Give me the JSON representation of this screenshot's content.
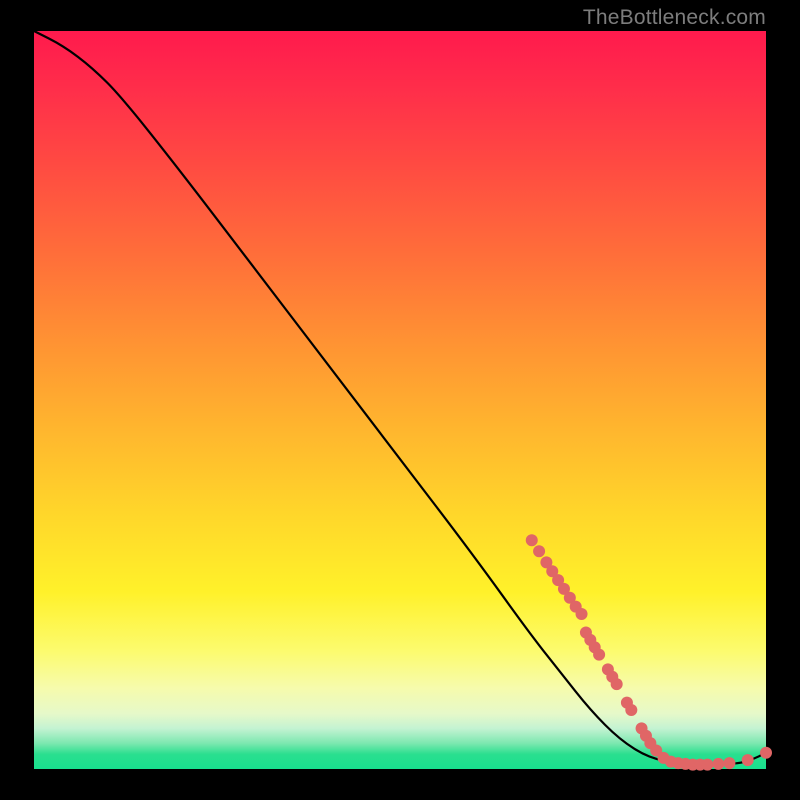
{
  "watermark": "TheBottleneck.com",
  "chart_data": {
    "type": "line",
    "title": "",
    "xlabel": "",
    "ylabel": "",
    "xlim": [
      0,
      100
    ],
    "ylim": [
      0,
      100
    ],
    "curve": {
      "x": [
        0,
        4,
        8,
        12,
        20,
        30,
        40,
        50,
        60,
        68,
        72,
        76,
        80,
        84,
        88,
        92,
        96,
        98,
        100
      ],
      "y": [
        100,
        98,
        95,
        91,
        81,
        68,
        55,
        42,
        29,
        18,
        13,
        8,
        4,
        1.5,
        0.8,
        0.6,
        0.7,
        1.2,
        2.2
      ]
    },
    "markers": [
      {
        "x": 68.0,
        "y": 31.0
      },
      {
        "x": 69.0,
        "y": 29.5
      },
      {
        "x": 70.0,
        "y": 28.0
      },
      {
        "x": 70.8,
        "y": 26.8
      },
      {
        "x": 71.6,
        "y": 25.6
      },
      {
        "x": 72.4,
        "y": 24.4
      },
      {
        "x": 73.2,
        "y": 23.2
      },
      {
        "x": 74.0,
        "y": 22.0
      },
      {
        "x": 74.8,
        "y": 21.0
      },
      {
        "x": 75.4,
        "y": 18.5
      },
      {
        "x": 76.0,
        "y": 17.5
      },
      {
        "x": 76.6,
        "y": 16.5
      },
      {
        "x": 77.2,
        "y": 15.5
      },
      {
        "x": 78.4,
        "y": 13.5
      },
      {
        "x": 79.0,
        "y": 12.5
      },
      {
        "x": 79.6,
        "y": 11.5
      },
      {
        "x": 81.0,
        "y": 9.0
      },
      {
        "x": 81.6,
        "y": 8.0
      },
      {
        "x": 83.0,
        "y": 5.5
      },
      {
        "x": 83.6,
        "y": 4.5
      },
      {
        "x": 84.2,
        "y": 3.5
      },
      {
        "x": 85.0,
        "y": 2.5
      },
      {
        "x": 86.0,
        "y": 1.5
      },
      {
        "x": 87.0,
        "y": 1.0
      },
      {
        "x": 88.0,
        "y": 0.8
      },
      {
        "x": 89.0,
        "y": 0.7
      },
      {
        "x": 90.0,
        "y": 0.6
      },
      {
        "x": 91.0,
        "y": 0.6
      },
      {
        "x": 92.0,
        "y": 0.6
      },
      {
        "x": 93.5,
        "y": 0.7
      },
      {
        "x": 95.0,
        "y": 0.8
      },
      {
        "x": 97.5,
        "y": 1.2
      },
      {
        "x": 100.0,
        "y": 2.2
      }
    ],
    "marker_color": "#e06666",
    "marker_radius_px": 6
  }
}
